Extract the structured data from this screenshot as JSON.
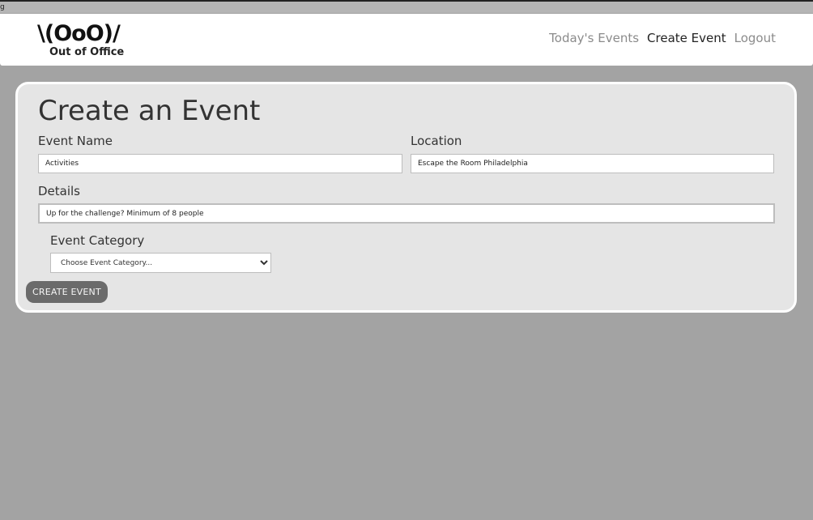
{
  "stray_text": "g",
  "brand": {
    "logo_mark": "\\(OoO)/",
    "logo_text": "Out of Office"
  },
  "nav": {
    "items": [
      {
        "label": "Today's Events",
        "active": false
      },
      {
        "label": "Create Event",
        "active": true
      },
      {
        "label": "Logout",
        "active": false
      }
    ]
  },
  "form": {
    "title": "Create an Event",
    "event_name": {
      "label": "Event Name",
      "value": "Activities"
    },
    "location": {
      "label": "Location",
      "value": "Escape the Room Philadelphia"
    },
    "details": {
      "label": "Details",
      "value": "Up for the challenge? Minimum of 8 people"
    },
    "category": {
      "label": "Event Category",
      "selected": "Choose Event Category..."
    },
    "submit_label": "CREATE EVENT"
  },
  "colors": {
    "page_background": "#a3a3a3",
    "card_background": "#e5e5e5",
    "button_background": "#6b6b6b",
    "nav_inactive": "#8b8b8b",
    "nav_active": "#222222"
  }
}
